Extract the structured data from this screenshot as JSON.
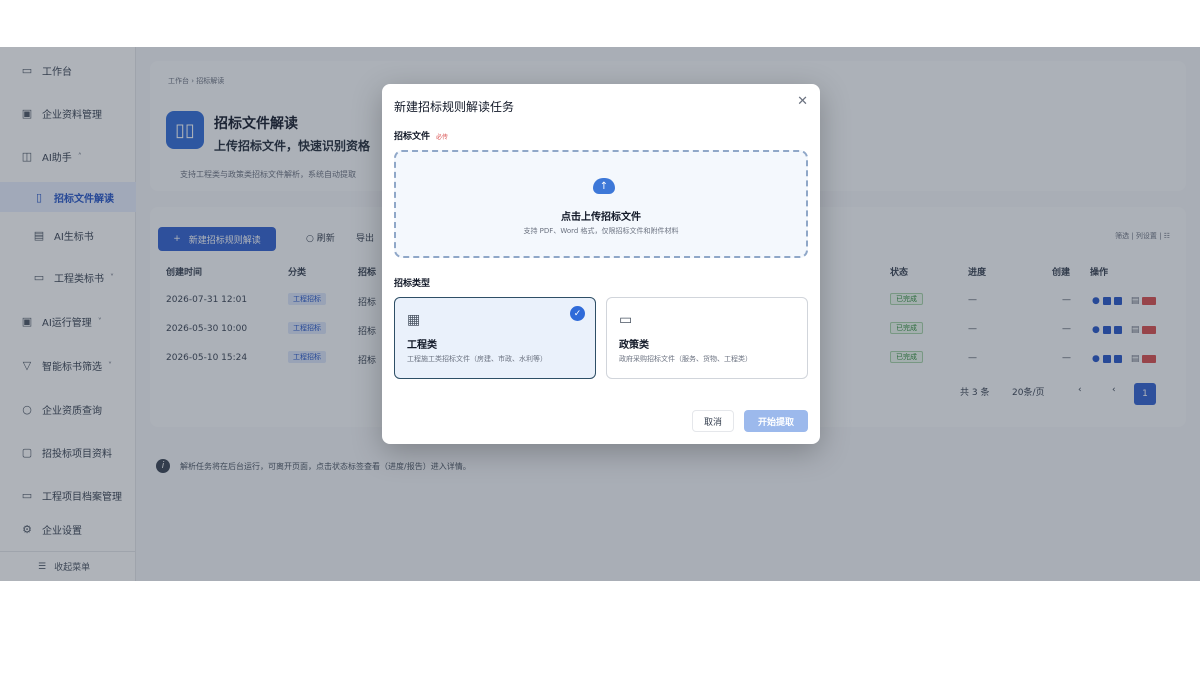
{
  "sidebar": {
    "items": [
      {
        "label": "工作台",
        "icon": "monitor-icon"
      },
      {
        "label": "企业资料管理",
        "icon": "folder-icon"
      },
      {
        "label": "AI助手",
        "icon": "ai-icon"
      },
      {
        "label": "招标文件解读",
        "icon": "book-icon"
      },
      {
        "label": "AI生标书",
        "icon": "document-icon"
      },
      {
        "label": "工程类标书",
        "icon": "folder-icon"
      },
      {
        "label": "AI运行管理",
        "icon": "monitor-icon"
      },
      {
        "label": "智能标书筛选",
        "icon": "filter-icon"
      },
      {
        "label": "企业资质查询",
        "icon": "search-icon"
      },
      {
        "label": "招投标项目资料",
        "icon": "briefcase-icon"
      },
      {
        "label": "工程项目档案管理",
        "icon": "archive-icon"
      },
      {
        "label": "企业设置",
        "icon": "settings-icon"
      }
    ],
    "footer_label": "收起菜单"
  },
  "header": {
    "breadcrumb": "工作台 › 招标解读",
    "title": "招标文件解读",
    "subtitle": "上传招标文件，快速识别资格",
    "description": "支持工程类与政策类招标文件解析，系统自动提取"
  },
  "toolbar": {
    "new_label": "新建招标规则解读",
    "refresh_label": "刷新",
    "export_label": "导出",
    "right_tools": "筛选  |  列设置  |  ☷"
  },
  "table": {
    "columns": [
      "创建时间",
      "分类",
      "招标",
      "状态",
      "进度",
      "创建",
      "操作"
    ],
    "rows": [
      {
        "time": "2026-07-31 12:01",
        "type": "工程招标",
        "name": "招标",
        "status": "已完成",
        "progress": "—",
        "creator": "—"
      },
      {
        "time": "2026-05-30 10:00",
        "type": "工程招标",
        "name": "招标",
        "status": "已完成",
        "progress": "—",
        "creator": "—"
      },
      {
        "time": "2026-05-10 15:24",
        "type": "工程招标",
        "name": "招标",
        "status": "已完成",
        "progress": "—",
        "creator": "—"
      }
    ],
    "total_label": "共 3 条",
    "page_size_label": "20条/页",
    "current_page": "1"
  },
  "tip": "解析任务将在后台运行，可离开页面，点击状态标签查看（进度/报告）进入详情。",
  "modal": {
    "title": "新建招标规则解读任务",
    "close_icon": "✕",
    "file_label": "招标文件",
    "required_label": "必传",
    "upload_main": "点击上传招标文件",
    "upload_hint": "支持 PDF、Word 格式，仅限招标文件和附件材料",
    "type_label": "招标类型",
    "types": [
      {
        "name": "工程类",
        "desc": "工程施工类招标文件（房建、市政、水利等）",
        "selected": true
      },
      {
        "name": "政策类",
        "desc": "政府采购招标文件（服务、货物、工程类）",
        "selected": false
      }
    ],
    "cancel_label": "取消",
    "start_label": "开始提取"
  }
}
